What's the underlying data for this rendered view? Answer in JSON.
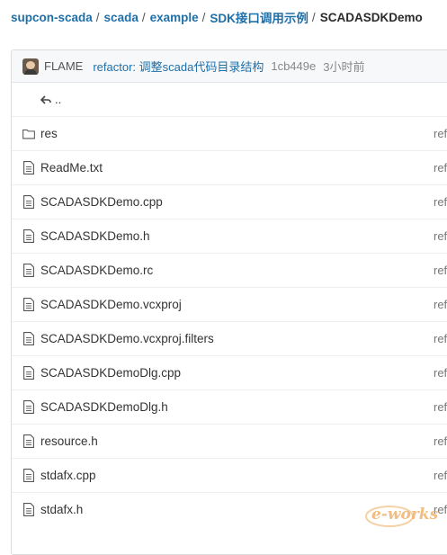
{
  "breadcrumb": {
    "items": [
      "supcon-scada",
      "scada",
      "example",
      "SDK接口调用示例",
      "SCADASDKDemo"
    ],
    "separator": "/"
  },
  "commit": {
    "avatar_icon": "user-avatar",
    "author": "FLAME",
    "message": "refactor: 调整scada代码目录结构",
    "sha": "1cb449e",
    "time": "3小时前"
  },
  "up": {
    "label": "..",
    "icon": "back-arrow-icon"
  },
  "files": [
    {
      "name": "res",
      "type": "folder",
      "right": "ref"
    },
    {
      "name": "ReadMe.txt",
      "type": "file",
      "right": "ref"
    },
    {
      "name": "SCADASDKDemo.cpp",
      "type": "file",
      "right": "ref"
    },
    {
      "name": "SCADASDKDemo.h",
      "type": "file",
      "right": "ref"
    },
    {
      "name": "SCADASDKDemo.rc",
      "type": "file",
      "right": "ref"
    },
    {
      "name": "SCADASDKDemo.vcxproj",
      "type": "file",
      "right": "ref"
    },
    {
      "name": "SCADASDKDemo.vcxproj.filters",
      "type": "file",
      "right": "ref"
    },
    {
      "name": "SCADASDKDemoDlg.cpp",
      "type": "file",
      "right": "ref"
    },
    {
      "name": "SCADASDKDemoDlg.h",
      "type": "file",
      "right": "ref"
    },
    {
      "name": "resource.h",
      "type": "file",
      "right": "ref"
    },
    {
      "name": "stdafx.cpp",
      "type": "file",
      "right": "ref"
    },
    {
      "name": "stdafx.h",
      "type": "file",
      "right": "ref"
    }
  ],
  "watermark": {
    "text": "e-works"
  },
  "colors": {
    "link": "#1f6fa8",
    "muted": "#888888",
    "border": "#dcdcdc"
  }
}
